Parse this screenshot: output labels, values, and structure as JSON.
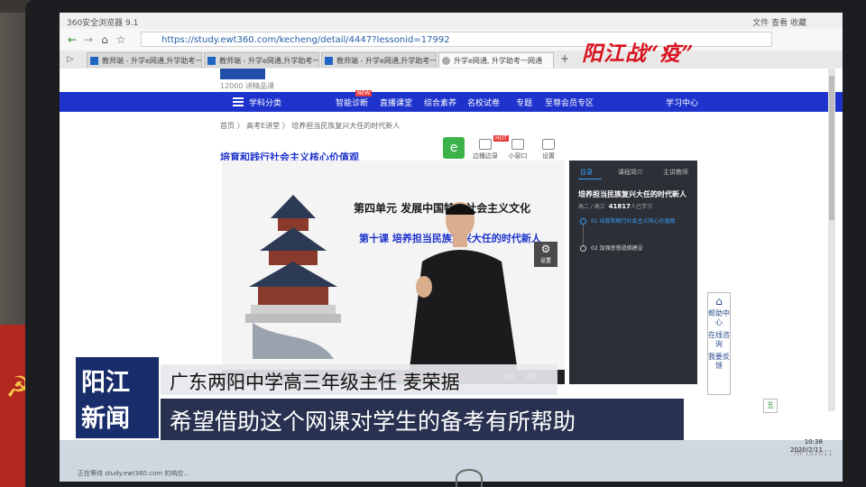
{
  "browser": {
    "window_title": "360安全浏览器 9.1",
    "window_menu": "文件   查看   收藏",
    "url": "https://study.ewt360.com/kecheng/detail/4447?lessonid=17992",
    "tabs": [
      {
        "label": "教师端 - 升学e网通,升学助考一网"
      },
      {
        "label": "教师端 - 升学e网通,升学助考一网"
      },
      {
        "label": "教师端 - 升学e网通,升学助考一网"
      },
      {
        "label": "升学e网通, 升学助考一网通"
      }
    ],
    "new_tab": "+",
    "status": "正在等待 study.ewt360.com 的响应..."
  },
  "site": {
    "subtitle": "12000 讲精品课",
    "nav": {
      "category": "学科分类",
      "items": [
        "智能诊断",
        "直播课堂",
        "综合素养",
        "名校试卷",
        "专题",
        "至尊会员专区"
      ],
      "hot_badge": "NEW",
      "right": "学习中心"
    },
    "breadcrumb": "首页  〉 高考E讲堂  〉 培养担当民族复兴大任的时代新人",
    "lesson_title": "培育和践行社会主义核心价值观",
    "tools": [
      "边播边录",
      "小窗口",
      "设置"
    ],
    "tool_hot": "HOT"
  },
  "player": {
    "unit_title": "第四单元   发展中国特色社会主义文化",
    "lesson_line": "第十课   培养担当民族复兴大任的时代新人",
    "gear_label": "设置",
    "controls": {
      "speed": "倍速",
      "quality": "清晰"
    }
  },
  "side_panel": {
    "tabs": [
      "目录",
      "课程简介",
      "主讲教师"
    ],
    "title": "培养担当民族复兴大任的时代新人",
    "grade": "高二 / 高三",
    "learners": "41817",
    "learners_suffix": "人已学习",
    "items": [
      "01 培育和践行社会主义核心价值观",
      "02 加强思想道德建设"
    ]
  },
  "help_column": [
    "帮助中心",
    "在线咨询",
    "我要反馈"
  ],
  "system": {
    "ime": "五",
    "time": "10:38",
    "date": "2020/2/11"
  },
  "overlay": {
    "watermark": "阳江战“疫”",
    "brand_line1": "阳江",
    "brand_line2": "新闻",
    "caption_name": "广东两阳中学高三年级主任  麦荣据",
    "caption_quote": "希望借助这个网课对学生的备考有所帮助"
  },
  "monitor_model": "HP LV2011",
  "colors": {
    "nav_blue": "#1d33cc",
    "brand_navy": "#1a2d6b",
    "watermark_red": "#d8121e"
  }
}
